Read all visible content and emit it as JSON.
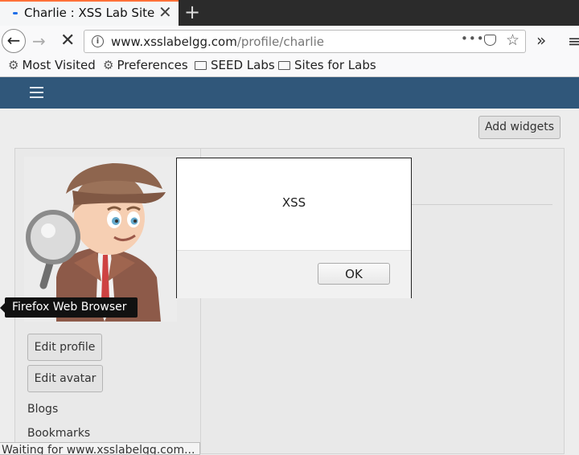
{
  "browser": {
    "tab": {
      "title": "Charlie : XSS Lab Site",
      "close_glyph": "✕"
    },
    "new_tab_glyph": "+",
    "nav": {
      "back_glyph": "←",
      "forward_glyph": "→",
      "stop_glyph": "✕"
    },
    "url": {
      "host": "www.xsslabelgg.com",
      "path": "/profile/charlie"
    },
    "bookmarks": [
      {
        "label": "Most Visited",
        "icon": "gear-icon"
      },
      {
        "label": "Preferences",
        "icon": "gear-icon"
      },
      {
        "label": "SEED Labs",
        "icon": "folder-icon"
      },
      {
        "label": "Sites for Labs",
        "icon": "folder-icon"
      }
    ],
    "status_text": "Waiting for www.xsslabelgg.com..."
  },
  "page": {
    "add_widgets_label": "Add widgets",
    "profile_buttons": {
      "edit_profile": "Edit profile",
      "edit_avatar": "Edit avatar"
    },
    "links": [
      "Blogs",
      "Bookmarks"
    ],
    "tooltip": "Firefox Web Browser"
  },
  "dialog": {
    "message": "XSS",
    "ok_label": "OK"
  },
  "colors": {
    "site_header": "#30577a",
    "tab_accent": "#ff7139"
  }
}
